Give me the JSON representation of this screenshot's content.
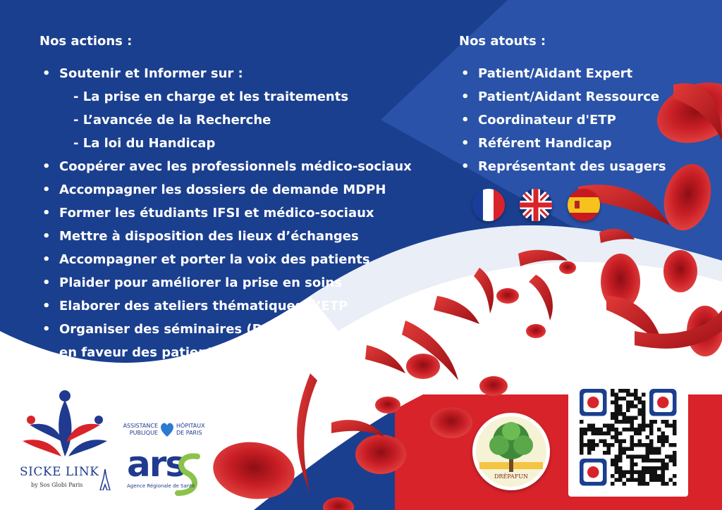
{
  "actions": {
    "heading": "Nos actions :",
    "items": [
      {
        "kind": "bullet",
        "text": "Soutenir et Informer sur :"
      },
      {
        "kind": "sub",
        "text": "- La prise en charge et les traitements"
      },
      {
        "kind": "sub",
        "text": "- L’avancée de la Recherche"
      },
      {
        "kind": "sub",
        "text": "- La loi du Handicap"
      },
      {
        "kind": "bullet",
        "text": "Coopérer avec les professionnels médico-sociaux"
      },
      {
        "kind": "bullet",
        "text": "Accompagner les dossiers de demande MDPH"
      },
      {
        "kind": "bullet",
        "text": "Former les étudiants IFSI et médico-sociaux"
      },
      {
        "kind": "bullet",
        "text": "Mettre à disposition des lieux d’échanges"
      },
      {
        "kind": "bullet",
        "text": "Accompagner et porter la voix des patients"
      },
      {
        "kind": "bullet",
        "text": "Plaider pour améliorer la prise en soins"
      },
      {
        "kind": "bullet",
        "text": "Elaborer des ateliers thématiques d’ETP"
      },
      {
        "kind": "bullet",
        "text": "Organiser des séminaires (DREPAFUN)"
      },
      {
        "kind": "cont",
        "text": "en faveur des patients et des aidants"
      }
    ]
  },
  "atouts": {
    "heading": "Nos atouts :",
    "items": [
      "Patient/Aidant Expert",
      "Patient/Aidant Ressource",
      "Coordinateur d'ETP",
      "Référent Handicap",
      "Représentant des usagers"
    ]
  },
  "flags": [
    "france-flag-icon",
    "uk-flag-icon",
    "spain-flag-icon"
  ],
  "logos": {
    "sicklink": {
      "name": "SICKE LINK",
      "tagline": "by Sos Globi Paris"
    },
    "aphp": {
      "left_top": "ASSISTANCE",
      "left_bottom": "PUBLIQUE",
      "right_top": "HÔPITAUX",
      "right_bottom": "DE PARIS"
    },
    "ars": {
      "mark": "ars",
      "subtitle": "Agence Régionale de Santé"
    },
    "drepafun": {
      "name": "DRÉPAFUN"
    }
  },
  "colors": {
    "navy": "#1b3f8f",
    "navy_light": "#2a52a8",
    "red": "#d8232a",
    "blood": "#b8141c",
    "white": "#ffffff"
  }
}
